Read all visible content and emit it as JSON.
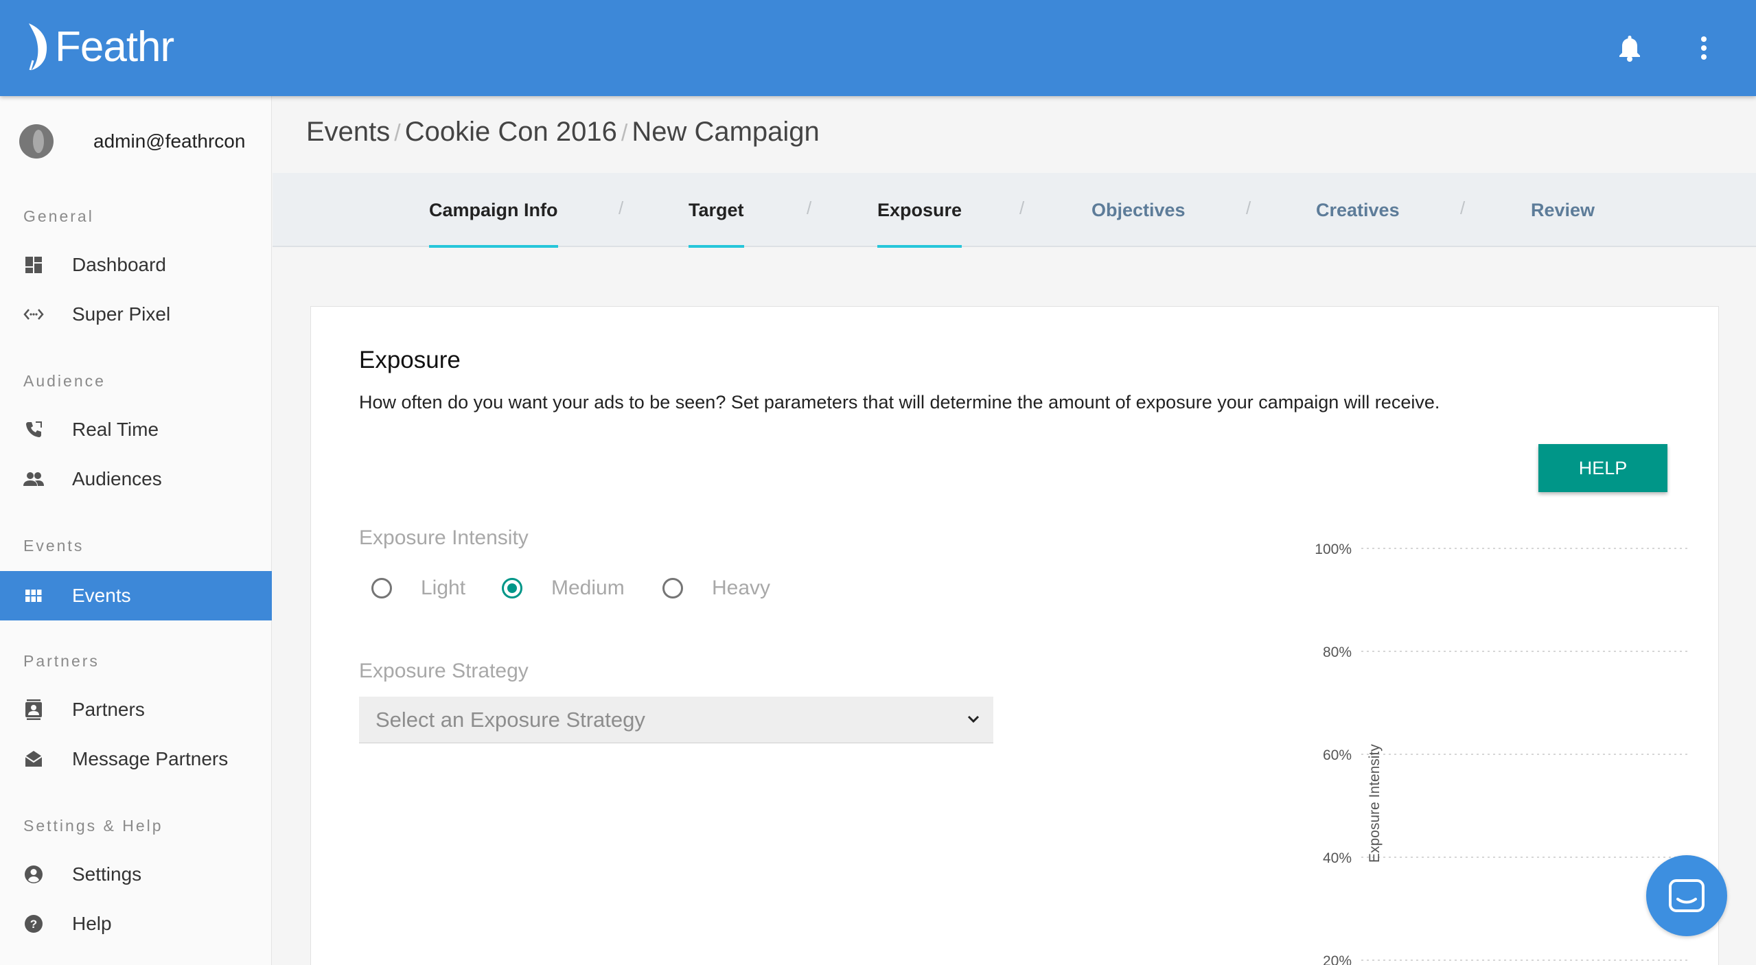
{
  "app": {
    "name": "Feathr"
  },
  "user": {
    "email": "admin@feathrcon"
  },
  "sidebar": {
    "sections": [
      {
        "label": "General",
        "items": [
          {
            "label": "Dashboard",
            "icon": "dashboard-icon"
          },
          {
            "label": "Super Pixel",
            "icon": "code-icon"
          }
        ]
      },
      {
        "label": "Audience",
        "items": [
          {
            "label": "Real Time",
            "icon": "phone-icon"
          },
          {
            "label": "Audiences",
            "icon": "people-icon"
          }
        ]
      },
      {
        "label": "Events",
        "items": [
          {
            "label": "Events",
            "icon": "grid-icon",
            "active": true
          }
        ]
      },
      {
        "label": "Partners",
        "items": [
          {
            "label": "Partners",
            "icon": "contact-icon"
          },
          {
            "label": "Message Partners",
            "icon": "mail-icon"
          }
        ]
      },
      {
        "label": "Settings & Help",
        "items": [
          {
            "label": "Settings",
            "icon": "account-icon"
          },
          {
            "label": "Help",
            "icon": "help-icon"
          }
        ]
      }
    ]
  },
  "breadcrumb": [
    "Events",
    "Cookie Con 2016",
    "New Campaign"
  ],
  "tabs": [
    {
      "label": "Campaign Info",
      "state": "done"
    },
    {
      "label": "Target",
      "state": "done"
    },
    {
      "label": "Exposure",
      "state": "done"
    },
    {
      "label": "Objectives",
      "state": "todo"
    },
    {
      "label": "Creatives",
      "state": "todo"
    },
    {
      "label": "Review",
      "state": "todo"
    }
  ],
  "tab_separator": "/",
  "exposure": {
    "title": "Exposure",
    "description": "How often do you want your ads to be seen? Set parameters that will determine the amount of exposure your campaign will receive.",
    "help_label": "HELP",
    "intensity_label": "Exposure Intensity",
    "intensity_options": [
      "Light",
      "Medium",
      "Heavy"
    ],
    "intensity_selected": "Medium",
    "strategy_label": "Exposure Strategy",
    "strategy_value": "Select an Exposure Strategy"
  },
  "colors": {
    "header": "#3d88d8",
    "accent": "#009688",
    "tab_underline": "#26c6da"
  },
  "chart_data": {
    "type": "line",
    "ylabel": "Exposure Intensity",
    "yticks": [
      "100%",
      "80%",
      "60%",
      "40%",
      "20%"
    ],
    "ylim": [
      0,
      100
    ],
    "grid": true,
    "series": []
  }
}
